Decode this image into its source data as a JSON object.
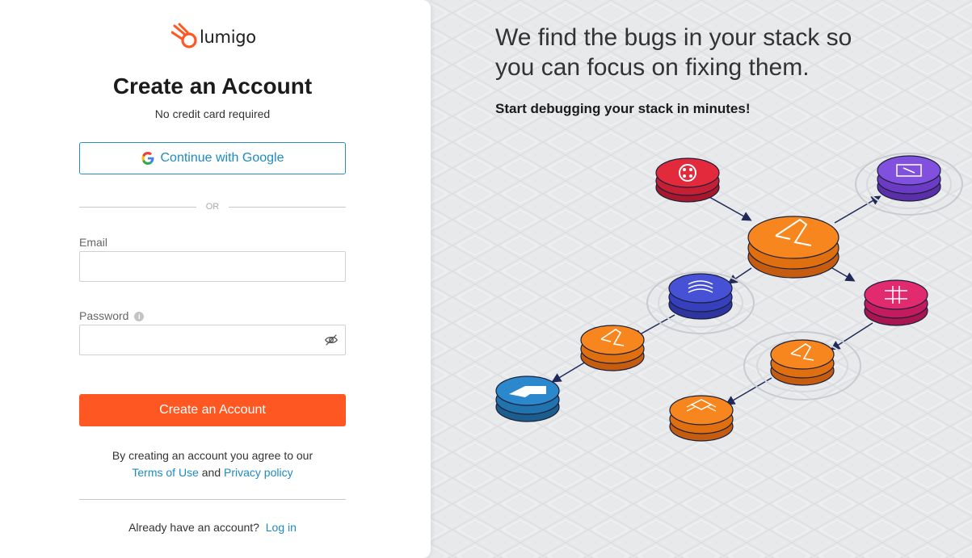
{
  "brand": {
    "name": "lumigo",
    "accent": "#ff5722",
    "link_color": "#1f8ac0"
  },
  "signup": {
    "title": "Create an Account",
    "subtitle": "No credit card required",
    "google_label": "Continue with Google",
    "or_text": "OR",
    "email_label": "Email",
    "email_value": "",
    "password_label": "Password",
    "password_value": "",
    "submit_label": "Create an Account",
    "terms_prefix": "By creating an account you agree to our",
    "terms_link": "Terms of Use",
    "terms_and": "and",
    "privacy_link": "Privacy policy",
    "login_prompt": "Already have an account?",
    "login_link": "Log in"
  },
  "hero": {
    "headline_line1": "We find the bugs in your stack so",
    "headline_line2": "you can focus on fixing them.",
    "subheadline": "Start debugging your stack in minutes!"
  },
  "illustration_nodes": [
    "twilio-node-icon",
    "aws-lambda-node-icon",
    "sqs-node-icon",
    "eventbridge-node-icon",
    "dynamodb-node-icon",
    "lambda-node-icon",
    "lambda-node-icon",
    "api-gateway-node-icon",
    "ec2-node-icon",
    "step-functions-node-icon"
  ]
}
